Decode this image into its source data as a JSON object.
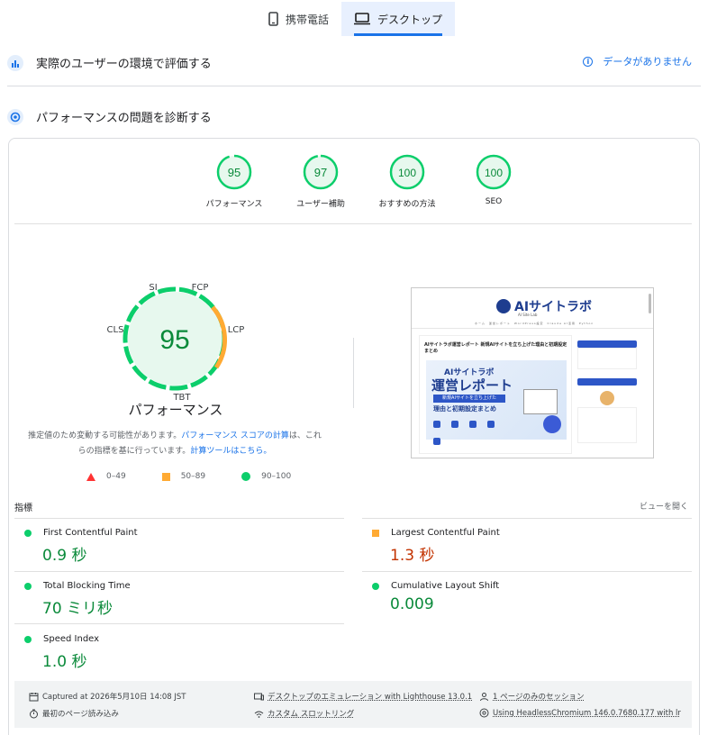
{
  "tabs": [
    {
      "label": "携帯電話",
      "icon": "mobile-icon",
      "active": false
    },
    {
      "label": "デスクトップ",
      "icon": "desktop-icon",
      "active": true
    }
  ],
  "field_section": {
    "title": "実際のユーザーの環境で評価する",
    "no_data": "データがありません"
  },
  "lab_section": {
    "title": "パフォーマンスの問題を診断する"
  },
  "categories": [
    {
      "score": "95",
      "label": "パフォーマンス"
    },
    {
      "score": "97",
      "label": "ユーザー補助"
    },
    {
      "score": "100",
      "label": "おすすめの方法"
    },
    {
      "score": "100",
      "label": "SEO"
    }
  ],
  "main_gauge": {
    "score": "95",
    "title": "パフォーマンス",
    "labels": {
      "si": "SI",
      "fcp": "FCP",
      "lcp": "LCP",
      "tbt": "TBT",
      "cls": "CLS"
    }
  },
  "note": {
    "part1": "推定値のため変動する可能性があります。",
    "link1": "パフォーマンス スコアの計算",
    "part2": "は、これらの指標を基に行っています。",
    "link2": "計算ツールはこちら。"
  },
  "legend": [
    {
      "range": "0–49",
      "color": "#ff3333"
    },
    {
      "range": "50–89",
      "color": "#ffaa33"
    },
    {
      "range": "90–100",
      "color": "#0cce6b"
    }
  ],
  "screenshot": {
    "logo": "AIサイトラボ",
    "logo_sub": "AI Site Lab",
    "nav": "ホーム　運営レポート　WordPress設定　Claude AI活用　Python",
    "post_title": "AIサイトラボ運営レポート 新規AIサイトを立ち上げた理由と初期設定まとめ",
    "banner_top": "AIサイトラボ",
    "banner_main": "運営レポート",
    "banner_tag": "新規AIサイトを立ち上げた",
    "banner_bottom": "理由と初期設定まとめ"
  },
  "metrics": {
    "heading": "指標",
    "expand_label": "ビューを開く",
    "items": [
      {
        "name": "First Contentful Paint",
        "value": "0.9 秒",
        "status": "good"
      },
      {
        "name": "Largest Contentful Paint",
        "value": "1.3 秒",
        "status": "average"
      },
      {
        "name": "Total Blocking Time",
        "value": "70 ミリ秒",
        "status": "good"
      },
      {
        "name": "Cumulative Layout Shift",
        "value": "0.009",
        "status": "good"
      },
      {
        "name": "Speed Index",
        "value": "1.0 秒",
        "status": "good"
      }
    ]
  },
  "run_info": {
    "captured": "Captured at 2026年5月10日 14:08 JST",
    "emulation": "デスクトップのエミュレーション with Lighthouse 13.0.1",
    "session": "1 ページのみのセッション",
    "load": "最初のページ読み込み",
    "throttling": "カスタム スロットリング",
    "browser": "Using HeadlessChromium 146.0.7680.177 with lr"
  },
  "colors": {
    "good": "#0cce6b",
    "average": "#ffaa33",
    "poor": "#ff3333",
    "accent": "#1a73e8"
  }
}
